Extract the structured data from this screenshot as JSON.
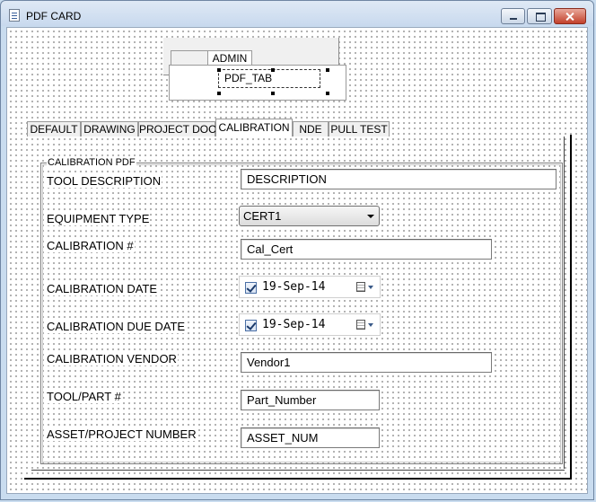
{
  "window": {
    "title": "PDF CARD"
  },
  "admin_tabs": {
    "tabs": [
      "",
      "ADMIN"
    ],
    "field": "PDF_TAB"
  },
  "main_tabs": [
    "DEFAULT",
    "DRAWING",
    "PROJECT DOC",
    "CALIBRATION",
    "NDE",
    "PULL TEST"
  ],
  "active_tab": "CALIBRATION",
  "group": {
    "title": "CALIBRATION PDF",
    "fields": {
      "tool_description": {
        "label": "TOOL DESCRIPTION",
        "value": "DESCRIPTION"
      },
      "equipment_type": {
        "label": "EQUIPMENT TYPE",
        "value": "CERT1"
      },
      "calibration_num": {
        "label": "CALIBRATION #",
        "value": "Cal_Cert"
      },
      "calibration_date": {
        "label": "CALIBRATION DATE",
        "value": "19-Sep-14",
        "checked": true
      },
      "calibration_due_date": {
        "label": "CALIBRATION DUE DATE",
        "value": "19-Sep-14",
        "checked": true
      },
      "calibration_vendor": {
        "label": "CALIBRATION VENDOR",
        "value": "Vendor1"
      },
      "tool_part": {
        "label": "TOOL/PART #",
        "value": "Part_Number"
      },
      "asset_project": {
        "label": "ASSET/PROJECT NUMBER",
        "value": "ASSET_NUM"
      }
    }
  },
  "colors": {
    "titlebar": "#c8d9ee",
    "close_button": "#c2402a",
    "grid_dot": "#000000"
  }
}
